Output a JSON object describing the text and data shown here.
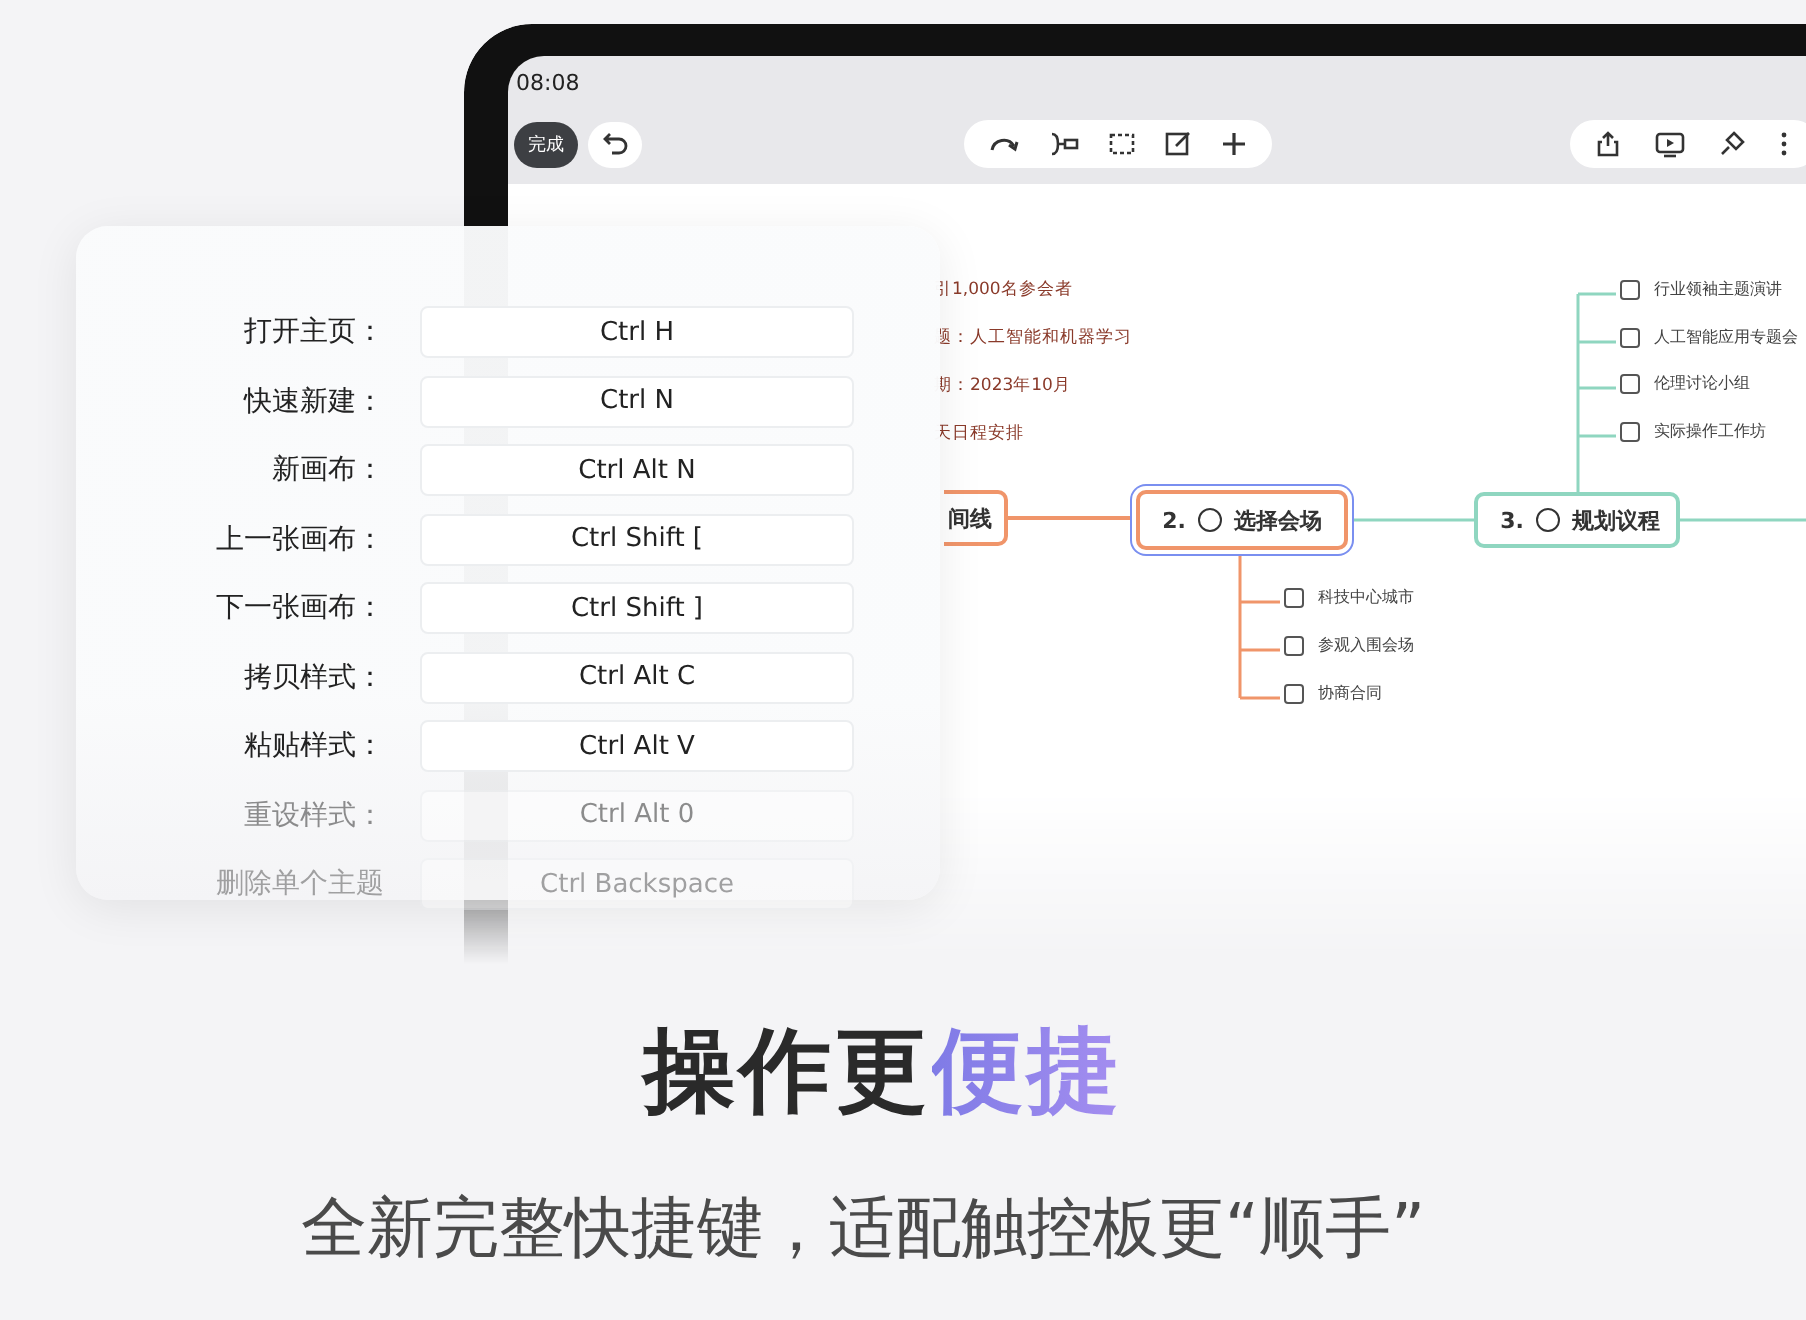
{
  "status_bar": {
    "time": "08:08"
  },
  "toolbar": {
    "done_button": "完成"
  },
  "mind_map": {
    "notes": [
      "引1,000名参会者",
      "题：人工智能和机器学习",
      "期：2023年10月",
      "天日程安排"
    ],
    "nodes": [
      {
        "label": "间线",
        "selected": false,
        "color": "#f0956a"
      },
      {
        "number": "2.",
        "label": "选择会场",
        "selected": true,
        "color": "#f0956a",
        "children": [
          {
            "label": "科技中心城市",
            "checked": false
          },
          {
            "label": "参观入围会场",
            "checked": false
          },
          {
            "label": "协商合同",
            "checked": false
          }
        ]
      },
      {
        "number": "3.",
        "label": "规划议程",
        "selected": false,
        "color": "#8fd6c0",
        "children": [
          {
            "label": "行业领袖主题演讲",
            "checked": false
          },
          {
            "label": "人工智能应用专题会",
            "checked": false
          },
          {
            "label": "伦理讨论小组",
            "checked": false
          },
          {
            "label": "实际操作工作坊",
            "checked": false
          }
        ]
      }
    ]
  },
  "shortcuts": [
    {
      "action": "打开主页：",
      "keys": "Ctrl H",
      "kind": "normal"
    },
    {
      "action": "快速新建：",
      "keys": "Ctrl N",
      "kind": "normal"
    },
    {
      "action": "新画布：",
      "keys": "Ctrl Alt N",
      "kind": "normal"
    },
    {
      "action": "上一张画布：",
      "keys": "Ctrl Shift [",
      "kind": "normal"
    },
    {
      "action": "下一张画布：",
      "keys": "Ctrl Shift ]",
      "kind": "normal"
    },
    {
      "action": "拷贝样式：",
      "keys": "Ctrl Alt C",
      "kind": "normal"
    },
    {
      "action": "粘贴样式：",
      "keys": "Ctrl Alt V",
      "kind": "normal"
    },
    {
      "action": "重设样式：",
      "keys": "Ctrl Alt 0",
      "kind": "faded"
    },
    {
      "action": "删除单个主题",
      "keys": "Ctrl Backspace",
      "kind": "ghost"
    }
  ],
  "headline": {
    "text": "操作更",
    "accent": "便捷"
  },
  "subtitle": "全新完整快捷键，适配触控板更“顺手”"
}
